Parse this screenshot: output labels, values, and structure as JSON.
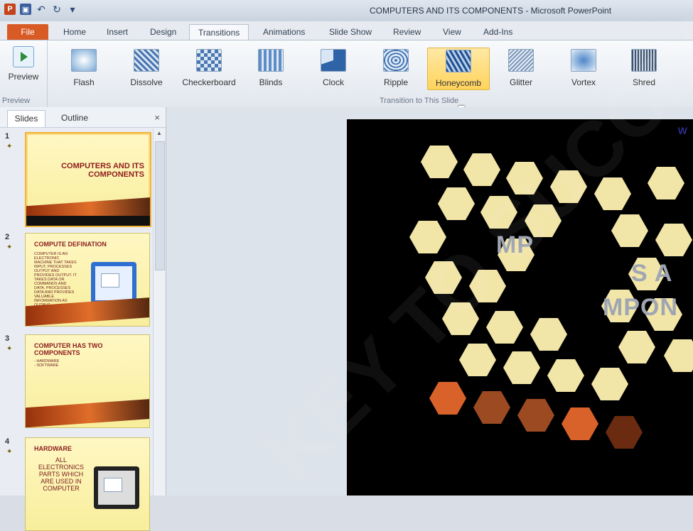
{
  "window": {
    "title": "COMPUTERS AND ITS COMPONENTS - Microsoft PowerPoint"
  },
  "tabs": [
    {
      "label": "File"
    },
    {
      "label": "Home"
    },
    {
      "label": "Insert"
    },
    {
      "label": "Design"
    },
    {
      "label": "Transitions"
    },
    {
      "label": "Animations"
    },
    {
      "label": "Slide Show"
    },
    {
      "label": "Review"
    },
    {
      "label": "View"
    },
    {
      "label": "Add-Ins"
    }
  ],
  "ribbon": {
    "preview_label": "Preview",
    "preview_group_label": "Preview",
    "transition_group_label": "Transition to This Slide",
    "transitions": [
      {
        "label": "Flash"
      },
      {
        "label": "Dissolve"
      },
      {
        "label": "Checkerboard"
      },
      {
        "label": "Blinds"
      },
      {
        "label": "Clock"
      },
      {
        "label": "Ripple"
      },
      {
        "label": "Honeycomb"
      },
      {
        "label": "Glitter"
      },
      {
        "label": "Vortex"
      },
      {
        "label": "Shred"
      }
    ]
  },
  "pane": {
    "tab_slides": "Slides",
    "tab_outline": "Outline",
    "close": "×"
  },
  "slides": [
    {
      "num": "1",
      "title": "COMPUTERS AND ITS COMPONENTS"
    },
    {
      "num": "2",
      "title": "COMPUTE DEFINATION",
      "body": "COMPUTER IS AN ELECTRONIC MACHINE THAT TAKES INPUT, PROCESSES OUTPUT AND PROVIDES OUTPUT. IT TAKES DATA OR COMMANDS AND DATA, PROCESSES DATA AND PROVIDES VALUABLE INFORMATION AS OUTPUT"
    },
    {
      "num": "3",
      "title": "COMPUTER HAS TWO COMPONENTS",
      "body1": "- HARDWARE",
      "body2": "- SOFTWARE"
    },
    {
      "num": "4",
      "title": "HARDWARE",
      "body": "ALL ELECTRONICS PARTS WHICH ARE USED IN COMPUTER"
    }
  ],
  "slide_view": {
    "text1": "MP",
    "text2": "S A",
    "text3": "MPON"
  }
}
